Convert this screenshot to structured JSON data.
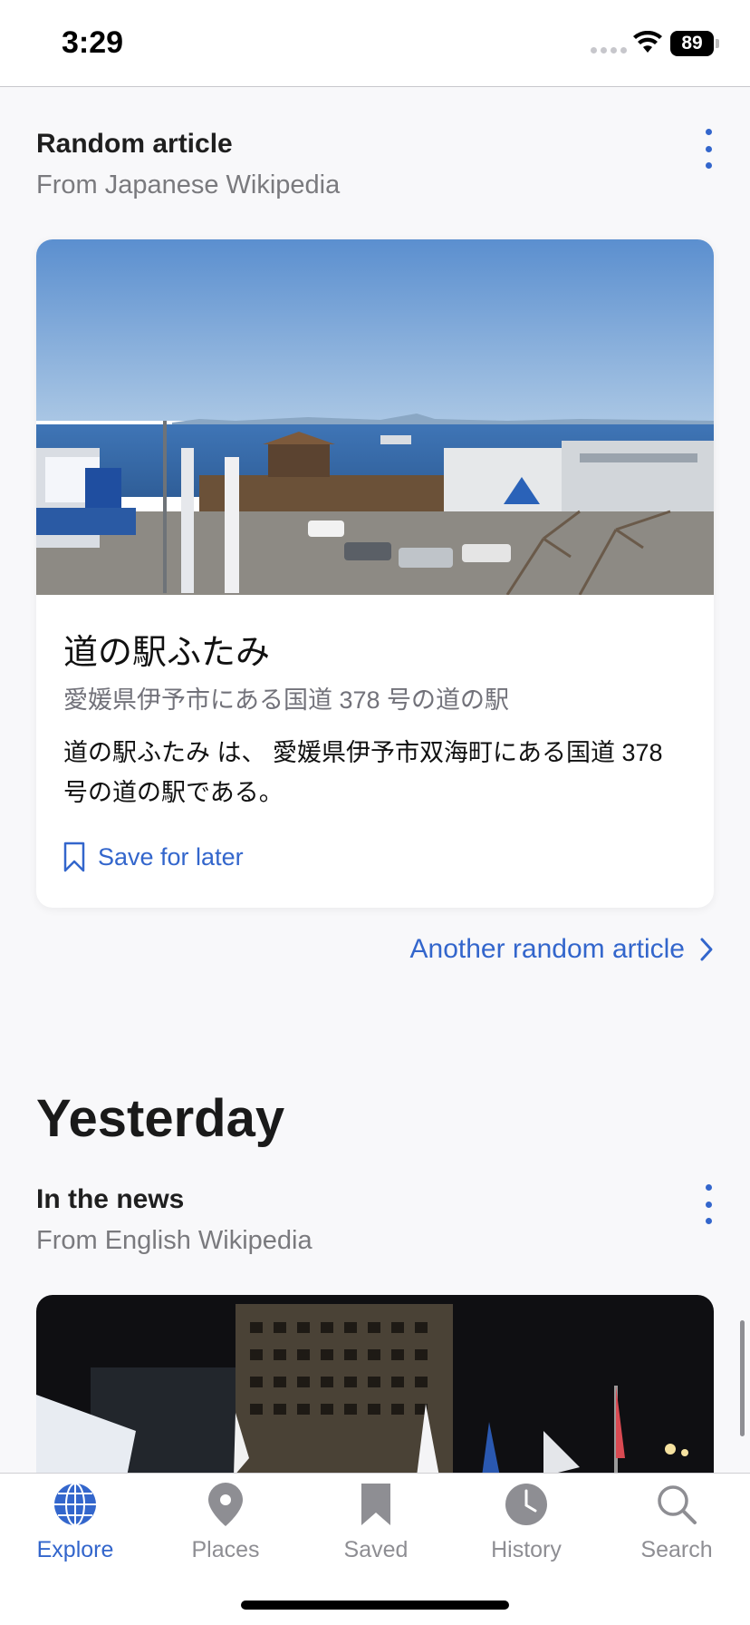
{
  "status_bar": {
    "time": "3:29",
    "battery": "89"
  },
  "random_section": {
    "title": "Random article",
    "subtitle": "From Japanese Wikipedia",
    "article": {
      "title": "道の駅ふたみ",
      "description": "愛媛県伊予市にある国道 378 号の道の駅",
      "extract": "道の駅ふたみ は、 愛媛県伊予市双海町にある国道 378 号の道の駅である。",
      "save_label": "Save for later"
    },
    "another_label": "Another random article"
  },
  "day_heading": "Yesterday",
  "news_section": {
    "title": "In the news",
    "subtitle": "From English Wikipedia"
  },
  "tabs": [
    {
      "label": "Explore",
      "icon": "globe-icon",
      "active": true
    },
    {
      "label": "Places",
      "icon": "map-pin-icon",
      "active": false
    },
    {
      "label": "Saved",
      "icon": "bookmark-icon",
      "active": false
    },
    {
      "label": "History",
      "icon": "clock-icon",
      "active": false
    },
    {
      "label": "Search",
      "icon": "magnifier-icon",
      "active": false
    }
  ],
  "colors": {
    "accent": "#3366cc",
    "inactive": "#8e8e93",
    "background": "#f8f8fa"
  }
}
